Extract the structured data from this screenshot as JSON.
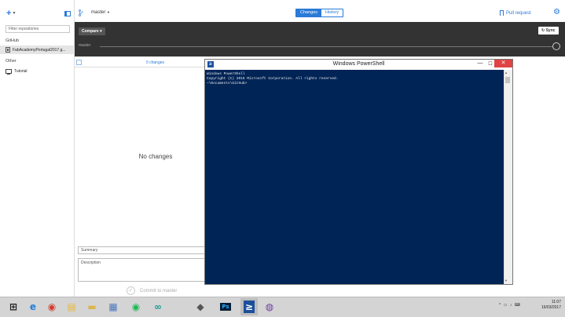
{
  "sidebar": {
    "filter_placeholder": "Filter repositories",
    "section_github": "GitHub",
    "repo_selected": "FabAcademyPortugal2017.g...",
    "section_other": "Other",
    "other_item": "Tutorial"
  },
  "toolbar": {
    "add_glyph": "+",
    "branch_name": "master",
    "tab_changes": "Changes",
    "tab_history": "History",
    "active_tab": "Changes",
    "pull_request": "Pull request",
    "settings_glyph": "⚙"
  },
  "compare_bar": {
    "compare_label": "Compare",
    "sync_label": "Sync",
    "timeline_branch": "master"
  },
  "changes_panel": {
    "count_label": "0 changes",
    "empty_message": "No changes",
    "summary_placeholder": "Summary",
    "description_placeholder": "Description",
    "commit_label": "Commit to master"
  },
  "powershell": {
    "title": "Windows PowerShell",
    "icon_glyph": "≥",
    "console_lines": [
      "Windows PowerShell",
      "Copyright (C) 2016 Microsoft Corporation. All rights reserved.",
      "",
      "~\\Documents\\GitHub>"
    ]
  },
  "taskbar": {
    "apps": [
      {
        "name": "start-icon",
        "glyph": "⊞",
        "color": "#1e1e1e",
        "bg": ""
      },
      {
        "name": "internet-explorer-icon",
        "glyph": "e",
        "color": "#1f7fd6",
        "bg": ""
      },
      {
        "name": "chrome-icon",
        "glyph": "◉",
        "color": "#d33b2c",
        "bg": ""
      },
      {
        "name": "file-explorer-icon",
        "glyph": "▤",
        "color": "#e8b73a",
        "bg": ""
      },
      {
        "name": "folder-icon",
        "glyph": "▬",
        "color": "#d9b650",
        "bg": ""
      },
      {
        "name": "document-icon",
        "glyph": "▦",
        "color": "#4a78c0",
        "bg": ""
      },
      {
        "name": "spotify-icon",
        "glyph": "◉",
        "color": "#1db954",
        "bg": ""
      },
      {
        "name": "arduino-icon",
        "glyph": "∞",
        "color": "#1a9c94",
        "bg": ""
      },
      {
        "name": "inkscape-icon",
        "glyph": "◆",
        "color": "#555555",
        "bg": ""
      },
      {
        "name": "photoshop-icon",
        "glyph": "Ps",
        "color": "#31a8ff",
        "bg": "#001e36"
      },
      {
        "name": "powershell-icon",
        "glyph": "≥",
        "color": "#ffffff",
        "bg": "#1b4f9c"
      },
      {
        "name": "github-desktop-icon",
        "glyph": "◍",
        "color": "#6e3aa8",
        "bg": ""
      }
    ],
    "tray": "^ ▭ ♪ ⌨",
    "time": "11:07",
    "date": "16/03/2017"
  }
}
